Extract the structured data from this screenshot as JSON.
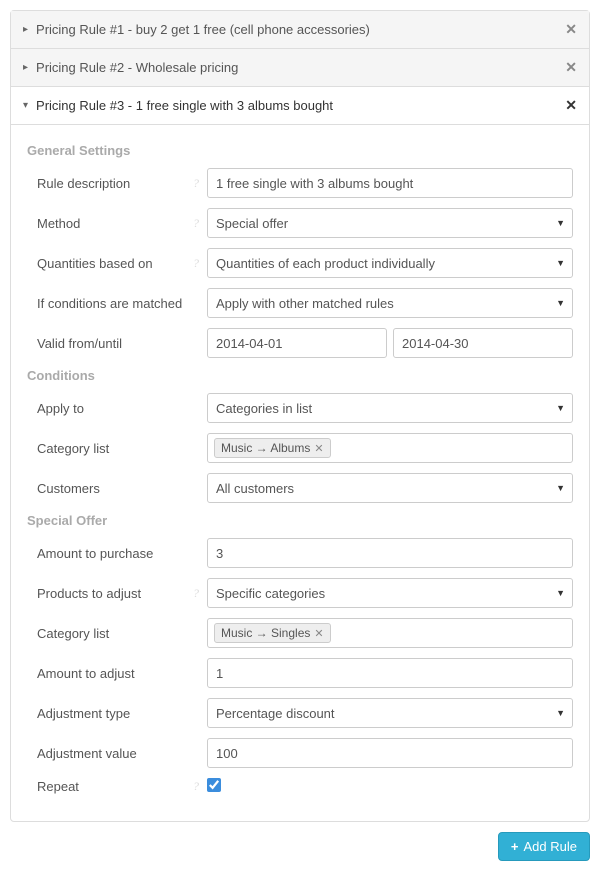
{
  "rules": {
    "r1": {
      "title": "Pricing Rule #1 - buy 2 get 1 free (cell phone accessories)"
    },
    "r2": {
      "title": "Pricing Rule #2 - Wholesale pricing"
    },
    "r3": {
      "title": "Pricing Rule #3 - 1 free single with 3 albums bought"
    }
  },
  "general": {
    "heading": "General Settings",
    "rule_description_label": "Rule description",
    "rule_description_value": "1 free single with 3 albums bought",
    "method_label": "Method",
    "method_value": "Special offer",
    "quantities_label": "Quantities based on",
    "quantities_value": "Quantities of each product individually",
    "conditions_matched_label": "If conditions are matched",
    "conditions_matched_value": "Apply with other matched rules",
    "valid_label": "Valid from/until",
    "valid_from": "2014-04-01",
    "valid_until": "2014-04-30"
  },
  "conditions": {
    "heading": "Conditions",
    "apply_to_label": "Apply to",
    "apply_to_value": "Categories in list",
    "category_list_label": "Category list",
    "category_tag": "Music → Albums",
    "customers_label": "Customers",
    "customers_value": "All customers"
  },
  "special": {
    "heading": "Special Offer",
    "amount_purchase_label": "Amount to purchase",
    "amount_purchase_value": "3",
    "products_adjust_label": "Products to adjust",
    "products_adjust_value": "Specific categories",
    "category_list_label": "Category list",
    "category_tag": "Music → Singles",
    "amount_adjust_label": "Amount to adjust",
    "amount_adjust_value": "1",
    "adjustment_type_label": "Adjustment type",
    "adjustment_type_value": "Percentage discount",
    "adjustment_value_label": "Adjustment value",
    "adjustment_value_value": "100",
    "repeat_label": "Repeat"
  },
  "footer": {
    "add_rule": "Add Rule"
  },
  "glyphs": {
    "help": "?",
    "x": "✕",
    "plus": "+"
  }
}
